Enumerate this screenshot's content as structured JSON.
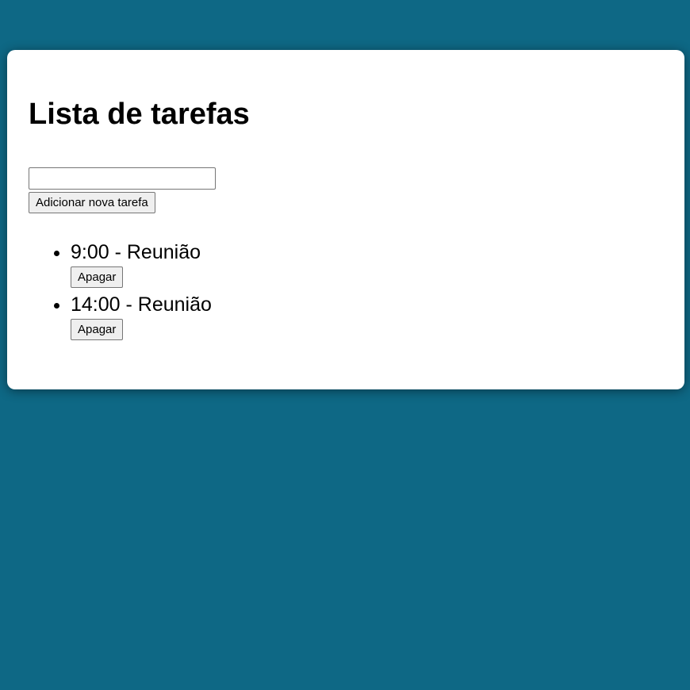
{
  "page": {
    "title": "Lista de tarefas",
    "background_color": "#0e6885",
    "card_color": "#ffffff"
  },
  "form": {
    "input_value": "",
    "input_placeholder": "",
    "add_button_label": "Adicionar nova tarefa"
  },
  "tasks": [
    {
      "text": "9:00 - Reunião",
      "delete_label": "Apagar"
    },
    {
      "text": "14:00 - Reunião",
      "delete_label": "Apagar"
    }
  ]
}
